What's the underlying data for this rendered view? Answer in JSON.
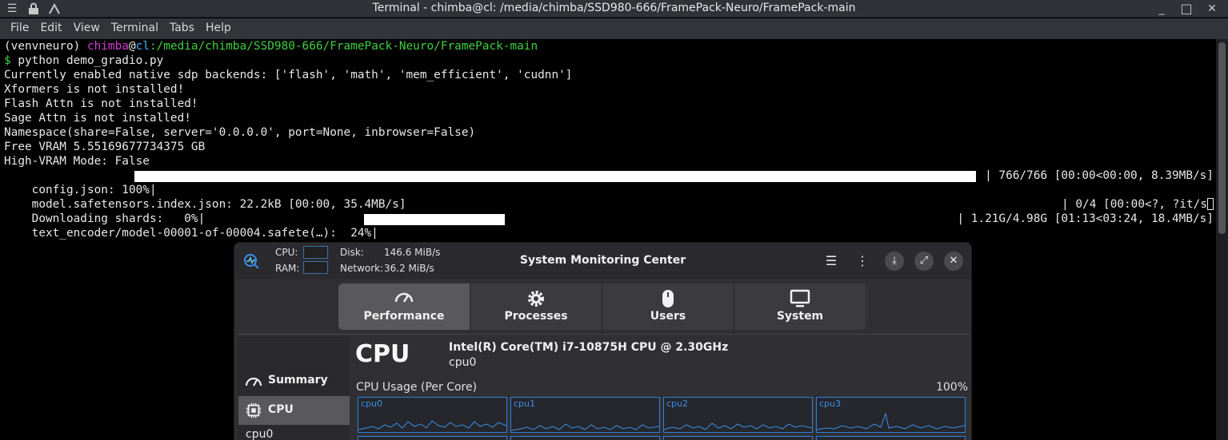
{
  "window": {
    "title": "Terminal - chimba@cl: /media/chimba/SSD980-666/FramePack-Neuro/FramePack-main",
    "controls": {
      "minimize": "_",
      "maximize": "□",
      "close": "✕"
    }
  },
  "menu": [
    "File",
    "Edit",
    "View",
    "Terminal",
    "Tabs",
    "Help"
  ],
  "terminal": {
    "venv": "(venvneuro) ",
    "user": "chimba",
    "at": "@",
    "host": "cl",
    "path": ":/media/chimba/SSD980-666/FramePack-Neuro/FramePack-main",
    "prompt": "$ ",
    "command": "python demo_gradio.py",
    "lines": [
      "Currently enabled native sdp backends: ['flash', 'math', 'mem_efficient', 'cudnn']",
      "Xformers is not installed!",
      "Flash Attn is not installed!",
      "Sage Attn is not installed!",
      "Namespace(share=False, server='0.0.0.0', port=None, inbrowser=False)",
      "Free VRAM 5.55169677734375 GB",
      "High-VRAM Mode: False"
    ],
    "progress": [
      {
        "left": "config.json: 100%|",
        "right": "| 766/766 [00:00<00:00, 8.39MB/s]",
        "fraction": 1.0
      },
      {
        "left": "model.safetensors.index.json: 22.2kB [00:00, 35.4MB/s]",
        "right": "",
        "fraction": 0
      },
      {
        "left": "Downloading shards:   0%|",
        "right": "| 0/4 [00:00<?, ?it/s",
        "fraction": 0
      },
      {
        "left": "text_encoder/model-00001-of-00004.safete(…):  24%|",
        "right": "| 1.21G/4.98G [01:13<03:24, 18.4MB/s]",
        "fraction": 0.24
      }
    ]
  },
  "monitor": {
    "title": "System Monitoring Center",
    "cpu_label": "CPU:",
    "ram_label": "RAM:",
    "disk_label": "Disk:",
    "disk_value": "146.6 MiB/s",
    "network_label": "Network:",
    "network_value": "36.2 MiB/s",
    "tabs": [
      "Performance",
      "Processes",
      "Users",
      "System"
    ],
    "active_tab": "Performance",
    "sidebar": [
      "Summary",
      "CPU"
    ],
    "sidebar_sub": "cpu0",
    "cpu_heading": "CPU",
    "cpu_model": "Intel(R) Core(TM) i7-10875H CPU @ 2.30GHz",
    "cpu_selected": "cpu0",
    "usage_label": "CPU Usage (Per Core)",
    "usage_max": "100%",
    "cores": [
      "cpu0",
      "cpu1",
      "cpu2",
      "cpu3"
    ],
    "colors": {
      "accent": "#2f7fd6",
      "graph_line": "#3b8fe8"
    }
  }
}
